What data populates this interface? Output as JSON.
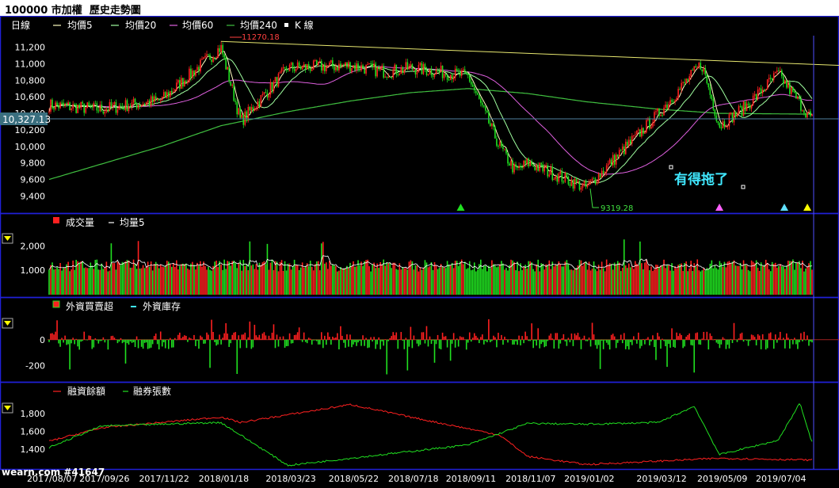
{
  "title": "100000 市加權  歷史走勢圖",
  "watermark": "wearn.com #41647",
  "annotation": "有得拖了",
  "colors": {
    "background": "#000000",
    "panel_border": "#2020d8",
    "up_bar": "#ff2020",
    "down_bar": "#20e020",
    "ma5": "#ffffc0",
    "ma20": "#a0ffa0",
    "ma60": "#e060e0",
    "ma240": "#40c040",
    "trendline": "#e8e870",
    "axis_text": "#ffffff"
  },
  "x_dates": [
    "2017/08/07",
    "2017/09/26",
    "2017/11/22",
    "2018/01/18",
    "2018/03/23",
    "2018/05/22",
    "2018/07/18",
    "2018/09/11",
    "2018/11/07",
    "2019/01/02",
    "2019/03/12",
    "2019/05/09",
    "2019/07/04"
  ],
  "chart_data": [
    {
      "type": "line",
      "panel": "price",
      "legend": {
        "label": "日線",
        "items": [
          "均價5",
          "均價20",
          "均價60",
          "均價240",
          "K 線"
        ]
      },
      "y_ticks": [
        9400,
        9600,
        9800,
        10000,
        10200,
        10400,
        10600,
        10800,
        11000,
        11200
      ],
      "ylim": [
        9260,
        11340
      ],
      "current_value": "10,327.13",
      "high_label": "11270.18",
      "low_label": "9319.28",
      "series": [
        {
          "name": "K 線",
          "style": "candles",
          "x": [
            "2017/08/07",
            "2017/09/26",
            "2017/11/22",
            "2018/01/18",
            "2018/02/06",
            "2018/03/23",
            "2018/05/22",
            "2018/06/25",
            "2018/07/18",
            "2018/09/11",
            "2018/10/11",
            "2018/10/26",
            "2018/11/07",
            "2019/01/02",
            "2019/03/12",
            "2019/04/22",
            "2019/05/09",
            "2019/06/03",
            "2019/07/04",
            "2019/08/05"
          ],
          "values": [
            10500,
            10450,
            10560,
            11200,
            10300,
            10950,
            10980,
            10900,
            10950,
            10850,
            10000,
            9700,
            9800,
            9500,
            10400,
            11000,
            10250,
            10480,
            10880,
            10330
          ]
        },
        {
          "name": "均價240",
          "x": [
            "2017/08/07",
            "2017/11/22",
            "2018/01/18",
            "2018/03/23",
            "2018/05/22",
            "2018/07/18",
            "2018/09/11",
            "2018/11/07",
            "2019/01/02",
            "2019/03/12",
            "2019/05/09",
            "2019/08/05"
          ],
          "values": [
            9600,
            10000,
            10250,
            10420,
            10550,
            10650,
            10700,
            10640,
            10540,
            10450,
            10400,
            10390
          ]
        }
      ],
      "trendline": {
        "from": [
          "2018/01/18",
          11270
        ],
        "to": [
          "2019/08/07",
          10980
        ]
      },
      "markers": [
        {
          "x": "2018/09/04",
          "color": "#20e020"
        },
        {
          "x": "2019/05/09",
          "color": "#ff60ff"
        },
        {
          "x": "2019/07/10",
          "color": "#60e0ff"
        },
        {
          "x": "2019/08/01",
          "color": "#ffff00"
        }
      ]
    },
    {
      "type": "bar",
      "panel": "volume",
      "legend": {
        "items": [
          "成交量",
          "均量5"
        ]
      },
      "y_ticks": [
        1000,
        2000
      ],
      "ylim": [
        0,
        2600
      ],
      "approx_values": {
        "typical": 1200,
        "peak": 2350
      }
    },
    {
      "type": "bar",
      "panel": "foreign",
      "legend": {
        "items": [
          "外資買賣超",
          "外資庫存"
        ]
      },
      "y_ticks": [
        -200,
        0
      ],
      "ylim": [
        -300,
        200
      ],
      "approx_values": {
        "max": 170,
        "min": -290
      }
    },
    {
      "type": "line",
      "panel": "margin",
      "legend": {
        "items": [
          "融資餘額",
          "融券張數"
        ]
      },
      "y_ticks": [
        1400,
        1600,
        1800
      ],
      "ylim": [
        1180,
        1950
      ],
      "series": [
        {
          "name": "融資餘額",
          "x": [
            "2017/08/07",
            "2017/09/26",
            "2018/01/18",
            "2018/02/06",
            "2018/05/22",
            "2018/07/18",
            "2018/10/11",
            "2018/11/07",
            "2019/01/02",
            "2019/05/09",
            "2019/08/05"
          ],
          "values": [
            1490,
            1640,
            1760,
            1700,
            1900,
            1760,
            1560,
            1320,
            1230,
            1300,
            1280
          ]
        },
        {
          "name": "融券張數",
          "x": [
            "2017/08/07",
            "2017/09/26",
            "2018/01/18",
            "2018/03/23",
            "2018/05/22",
            "2018/09/11",
            "2018/11/07",
            "2019/01/02",
            "2019/03/12",
            "2019/04/15",
            "2019/05/09",
            "2019/07/04",
            "2019/07/25",
            "2019/08/05"
          ],
          "values": [
            1420,
            1660,
            1700,
            1220,
            1300,
            1450,
            1690,
            1680,
            1700,
            1880,
            1340,
            1500,
            1920,
            1480
          ]
        }
      ]
    }
  ]
}
